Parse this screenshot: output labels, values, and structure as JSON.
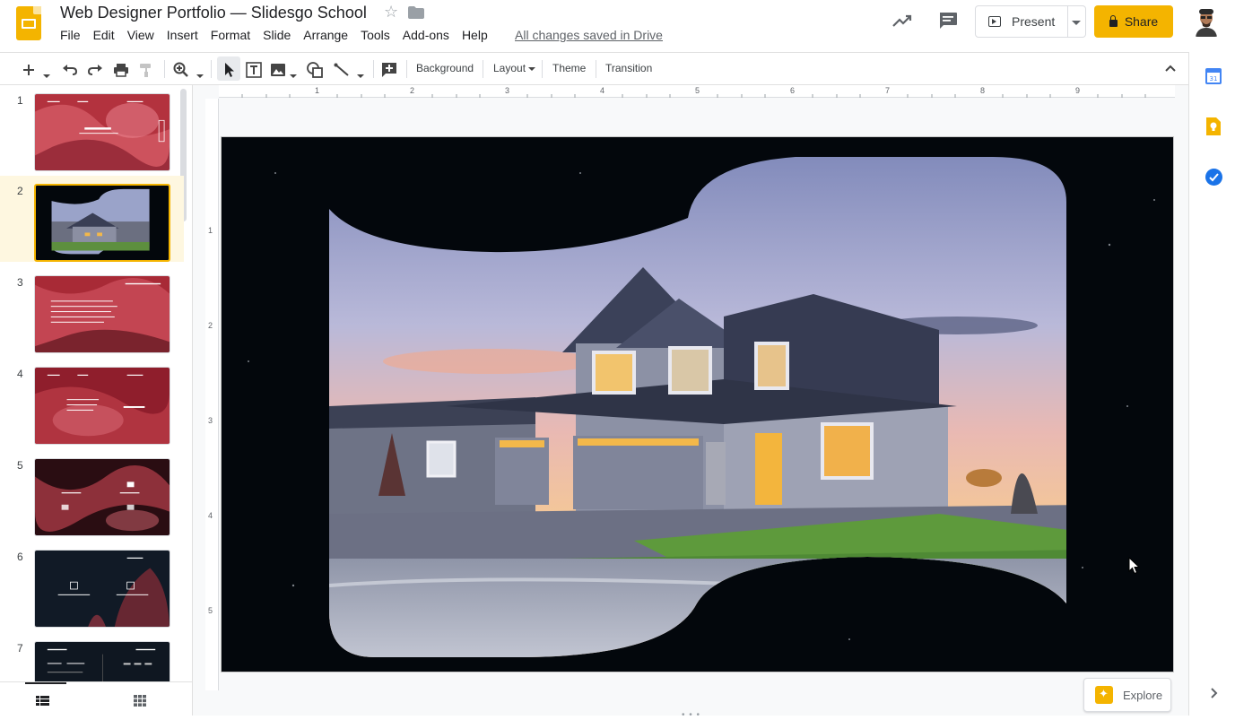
{
  "header": {
    "doc_title": "Web Designer Portfolio — Slidesgo School",
    "menu": [
      "File",
      "Edit",
      "View",
      "Insert",
      "Format",
      "Slide",
      "Arrange",
      "Tools",
      "Add-ons",
      "Help"
    ],
    "save_status": "All changes saved in Drive",
    "present_label": "Present",
    "share_label": "Share"
  },
  "toolbar": {
    "background_label": "Background",
    "layout_label": "Layout",
    "theme_label": "Theme",
    "transition_label": "Transition"
  },
  "ruler": {
    "top": [
      "1",
      "2",
      "3",
      "4",
      "5",
      "6",
      "7",
      "8",
      "9"
    ],
    "left": [
      "1",
      "2",
      "3",
      "4",
      "5"
    ]
  },
  "filmstrip": {
    "slides": [
      {
        "number": "1",
        "theme": "red-smoke"
      },
      {
        "number": "2",
        "theme": "house"
      },
      {
        "number": "3",
        "theme": "red-smoke"
      },
      {
        "number": "4",
        "theme": "red-smoke"
      },
      {
        "number": "5",
        "theme": "dark-red-smoke"
      },
      {
        "number": "6",
        "theme": "dark-navy"
      },
      {
        "number": "7",
        "theme": "dark-navy"
      }
    ],
    "selected": 2
  },
  "explore_label": "Explore",
  "colors": {
    "accent": "#f4b400",
    "slide_bg": "#03070c"
  }
}
